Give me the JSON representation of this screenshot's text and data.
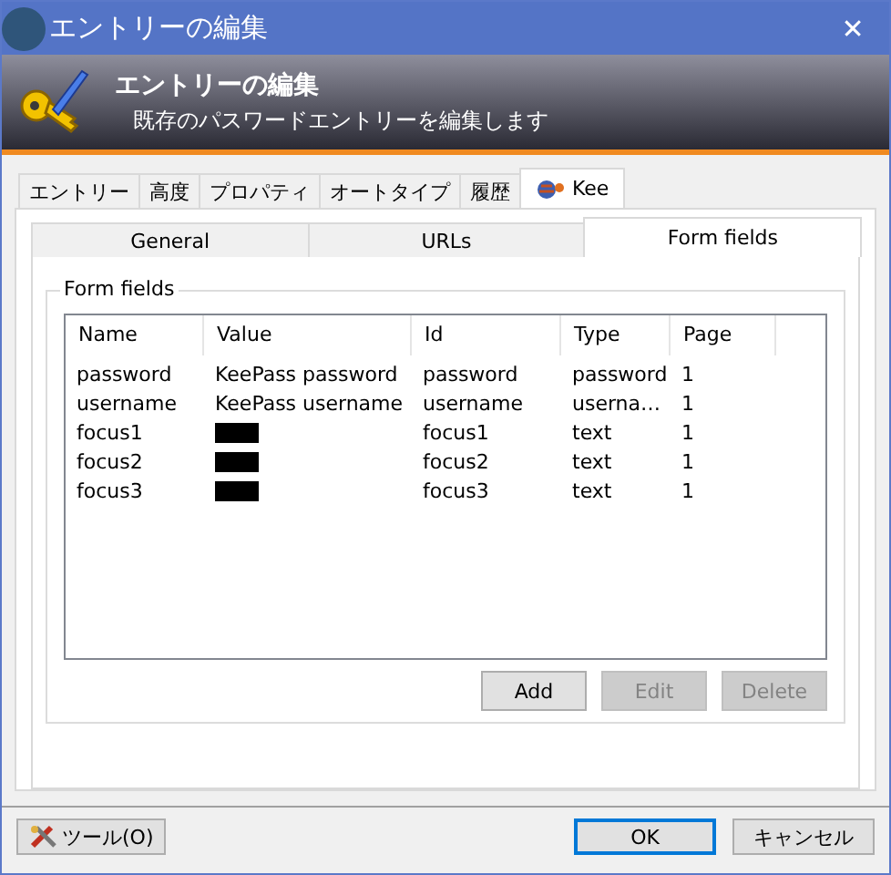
{
  "window": {
    "title": "エントリーの編集",
    "close": "✕"
  },
  "banner": {
    "title": "エントリーの編集",
    "subtitle": "既存のパスワードエントリーを編集します"
  },
  "tabs": [
    {
      "label": "エントリー",
      "selected": false
    },
    {
      "label": "高度",
      "selected": false
    },
    {
      "label": "プロパティ",
      "selected": false
    },
    {
      "label": "オートタイプ",
      "selected": false
    },
    {
      "label": "履歴",
      "selected": false
    },
    {
      "label": "Kee",
      "selected": true,
      "icon": true
    }
  ],
  "subtabs": [
    {
      "label": "General",
      "selected": false
    },
    {
      "label": "URLs",
      "selected": false
    },
    {
      "label": "Form fields",
      "selected": true
    }
  ],
  "group": {
    "title": "Form fields"
  },
  "table": {
    "columns": [
      "Name",
      "Value",
      "Id",
      "Type",
      "Page"
    ],
    "rows": [
      {
        "name": "password",
        "value": "KeePass password",
        "redacted": false,
        "id": "password",
        "type": "password",
        "page": "1"
      },
      {
        "name": "username",
        "value": "KeePass username",
        "redacted": false,
        "id": "username",
        "type": "userna…",
        "page": "1"
      },
      {
        "name": "focus1",
        "redacted": true,
        "id": "focus1",
        "type": "text",
        "page": "1"
      },
      {
        "name": "focus2",
        "redacted": true,
        "id": "focus2",
        "type": "text",
        "page": "1"
      },
      {
        "name": "focus3",
        "redacted": true,
        "id": "focus3",
        "type": "text",
        "page": "1"
      }
    ]
  },
  "table_buttons": [
    {
      "label": "Add",
      "disabled": false
    },
    {
      "label": "Edit",
      "disabled": true
    },
    {
      "label": "Delete",
      "disabled": true
    }
  ],
  "footer": {
    "tools": "ツール(O)",
    "ok": "OK",
    "cancel": "キャンセル"
  }
}
